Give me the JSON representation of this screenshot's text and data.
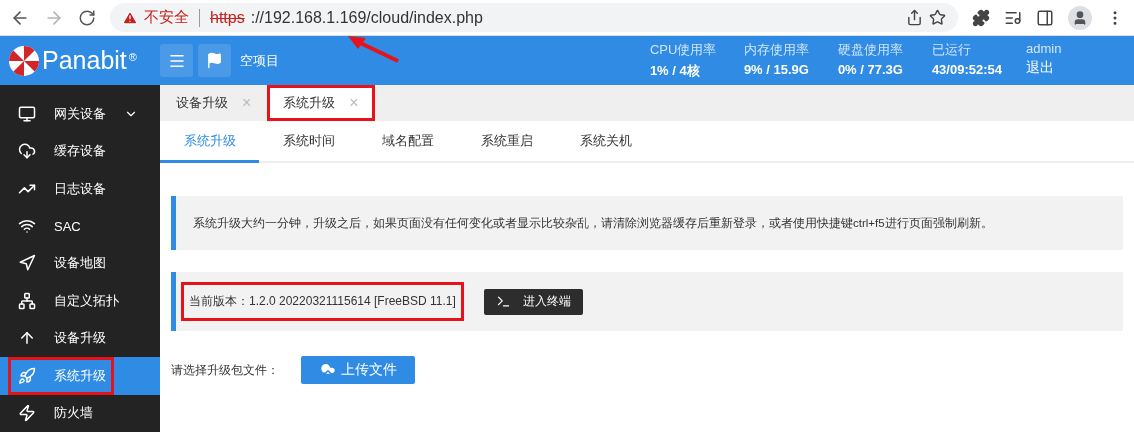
{
  "browser": {
    "security_label": "不安全",
    "url_scheme": "https",
    "url_rest": "://192.168.1.169/cloud/index.php",
    "back_disabled": false,
    "forward_disabled": true
  },
  "header": {
    "logo": "Panabit",
    "logo_mark": "®",
    "project": "空项目",
    "stats": [
      {
        "label": "CPU使用率",
        "value": "1% / 4核"
      },
      {
        "label": "内存使用率",
        "value": "9% / 15.9G"
      },
      {
        "label": "硬盘使用率",
        "value": "0% / 77.3G"
      },
      {
        "label": "已运行",
        "value": "43/09:52:54"
      }
    ],
    "user": "admin",
    "logout": "退出"
  },
  "sidebar": {
    "items": [
      {
        "label": "网关设备",
        "selected": false,
        "expandable": true,
        "annotated": false
      },
      {
        "label": "缓存设备",
        "selected": false,
        "expandable": false,
        "annotated": false
      },
      {
        "label": "日志设备",
        "selected": false,
        "expandable": false,
        "annotated": false
      },
      {
        "label": "SAC",
        "selected": false,
        "expandable": false,
        "annotated": false
      },
      {
        "label": "设备地图",
        "selected": false,
        "expandable": false,
        "annotated": false
      },
      {
        "label": "自定义拓扑",
        "selected": false,
        "expandable": false,
        "annotated": false
      },
      {
        "label": "设备升级",
        "selected": false,
        "expandable": false,
        "annotated": false
      },
      {
        "label": "系统升级",
        "selected": true,
        "expandable": false,
        "annotated": true
      },
      {
        "label": "防火墙",
        "selected": false,
        "expandable": false,
        "annotated": false
      }
    ]
  },
  "page_tabs": [
    {
      "label": "设备升级",
      "selected": false,
      "annotated": false,
      "close": "×"
    },
    {
      "label": "系统升级",
      "selected": true,
      "annotated": true,
      "close": "×"
    }
  ],
  "sub_tabs": [
    {
      "label": "系统升级",
      "selected": true
    },
    {
      "label": "系统时间",
      "selected": false
    },
    {
      "label": "域名配置",
      "selected": false
    },
    {
      "label": "系统重启",
      "selected": false
    },
    {
      "label": "系统关机",
      "selected": false
    }
  ],
  "notice": "系统升级大约一分钟，升级之后，如果页面没有任何变化或者显示比较杂乱，请清除浏览器缓存后重新登录，或者使用快捷键ctrl+f5进行页面强制刷新。",
  "version": {
    "text": "当前版本：1.2.0 20220321115614 [FreeBSD 11.1]",
    "annotated": true,
    "terminal_button": "进入终端"
  },
  "upload": {
    "label": "请选择升级包文件：",
    "button": "上传文件"
  }
}
